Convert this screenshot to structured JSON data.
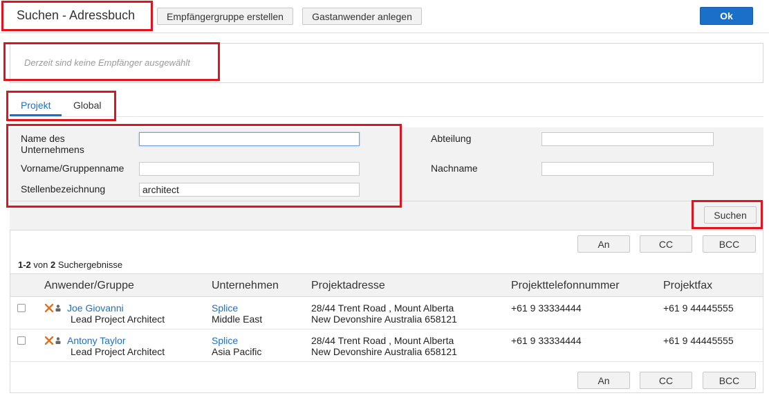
{
  "header": {
    "title": "Suchen - Adressbuch",
    "create_group_label": "Empfängergruppe erstellen",
    "guest_user_label": "Gastanwender anlegen",
    "ok_label": "Ok"
  },
  "recipients": {
    "empty_text": "Derzeit sind keine Empfänger ausgewählt"
  },
  "tabs": [
    {
      "label": "Projekt",
      "active": true
    },
    {
      "label": "Global",
      "active": false
    }
  ],
  "form": {
    "company_label": "Name des Unternehmens",
    "company_value": "",
    "firstname_label": "Vorname/Gruppenname",
    "firstname_value": "",
    "jobtitle_label": "Stellenbezeichnung",
    "jobtitle_value": "architect",
    "department_label": "Abteilung",
    "department_value": "",
    "lastname_label": "Nachname",
    "lastname_value": "",
    "search_label": "Suchen"
  },
  "actions": {
    "to_label": "An",
    "cc_label": "CC",
    "bcc_label": "BCC"
  },
  "results": {
    "range": "1-2",
    "of": "von",
    "total": "2",
    "suffix": "Suchergebnisse",
    "columns": [
      "Anwender/Gruppe",
      "Unternehmen",
      "Projektadresse",
      "Projekttelefonnummer",
      "Projektfax"
    ],
    "rows": [
      {
        "name": "Joe Giovanni",
        "title": "Lead Project Architect",
        "company": "Splice",
        "region": "Middle East",
        "address1": "28/44 Trent Road , Mount Alberta",
        "address2": "New Devonshire Australia 658121",
        "phone": "+61 9 33334444",
        "fax": "+61 9 44445555"
      },
      {
        "name": "Antony Taylor",
        "title": "Lead Project Architect",
        "company": "Splice",
        "region": "Asia Pacific",
        "address1": "28/44 Trent Road , Mount Alberta",
        "address2": "New Devonshire Australia 658121",
        "phone": "+61 9 33334444",
        "fax": "+61 9 44445555"
      }
    ]
  },
  "colors": {
    "accent": "#1a6fc9",
    "highlight": "#e0141e",
    "logo_orange": "#e0701e"
  }
}
